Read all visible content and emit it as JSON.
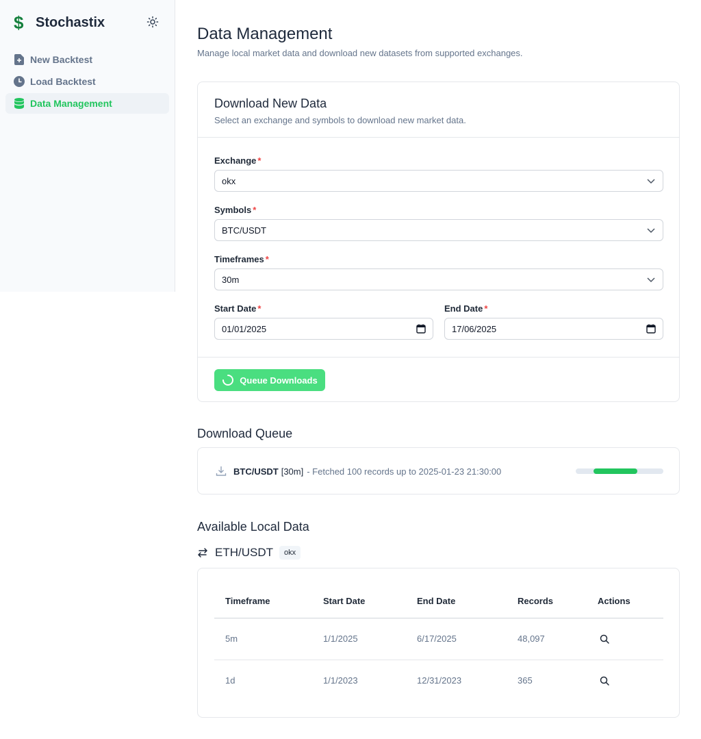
{
  "app": {
    "name": "Stochastix",
    "logo_glyph": "$"
  },
  "nav": {
    "items": [
      {
        "label": "New Backtest",
        "icon": "file-plus-icon",
        "active": false
      },
      {
        "label": "Load Backtest",
        "icon": "clock-icon",
        "active": false
      },
      {
        "label": "Data Management",
        "icon": "database-icon",
        "active": true
      }
    ]
  },
  "page": {
    "title": "Data Management",
    "subtitle": "Manage local market data and download new datasets from supported exchanges."
  },
  "download": {
    "title": "Download New Data",
    "subtitle": "Select an exchange and symbols to download new market data.",
    "exchange": {
      "label": "Exchange",
      "required_mark": "*",
      "value": "okx"
    },
    "symbols": {
      "label": "Symbols",
      "required_mark": "*",
      "value": "BTC/USDT"
    },
    "timeframes": {
      "label": "Timeframes",
      "required_mark": "*",
      "value": "30m"
    },
    "start_date": {
      "label": "Start Date",
      "required_mark": "*",
      "value": "01/01/2025"
    },
    "end_date": {
      "label": "End Date",
      "required_mark": "*",
      "value": "17/06/2025"
    },
    "submit_label": "Queue Downloads"
  },
  "queue": {
    "title": "Download Queue",
    "items": [
      {
        "symbol": "BTC/USDT",
        "timeframe": "[30m]",
        "status": "- Fetched 100 records up to 2025-01-23 21:30:00",
        "progress_start": 0.2,
        "progress_end": 0.7
      }
    ]
  },
  "local_data": {
    "title": "Available Local Data",
    "pair": "ETH/USDT",
    "exchange_badge": "okx",
    "columns": [
      "Timeframe",
      "Start Date",
      "End Date",
      "Records",
      "Actions"
    ],
    "rows": [
      {
        "timeframe": "5m",
        "start": "1/1/2025",
        "end": "6/17/2025",
        "records": "48,097"
      },
      {
        "timeframe": "1d",
        "start": "1/1/2023",
        "end": "12/31/2023",
        "records": "365"
      }
    ]
  },
  "colors": {
    "accent": "#22c55e",
    "button": "#4ade80",
    "required": "#ef4444"
  }
}
